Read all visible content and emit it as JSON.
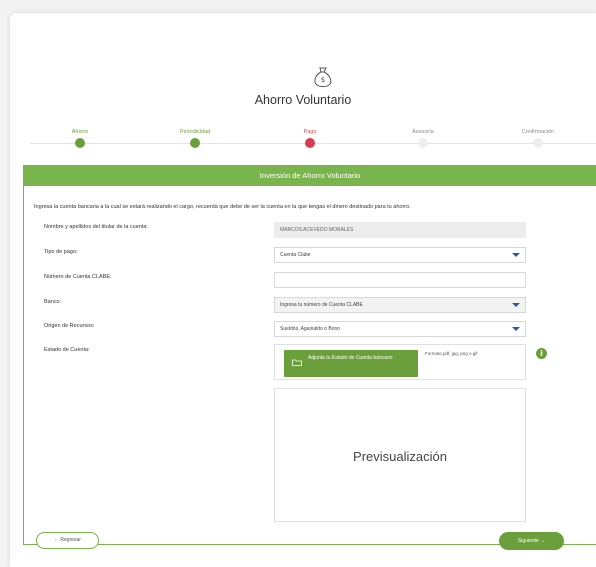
{
  "page": {
    "title": "Ahorro Voluntario",
    "icon": "money-bag-icon"
  },
  "steps": [
    {
      "label": "Ahorro",
      "state": "done"
    },
    {
      "label": "Periodicidad",
      "state": "done"
    },
    {
      "label": "Pago",
      "state": "current"
    },
    {
      "label": "Asesoría",
      "state": "todo"
    },
    {
      "label": "Confirmación",
      "state": "todo"
    }
  ],
  "section": {
    "title": "Inversión de Ahorro Voluntario",
    "intro": "Ingresa la cuenta bancaria a la cual se estará realizando el cargo, recuerda que debe de ser la cuenta en la que tengas el dinero destinado para tu ahorro."
  },
  "form": {
    "holder_label": "Nombre y apellidos del titular de la cuenta:",
    "holder_value": "MARCOS ACEVEDO MORALES",
    "payment_type_label": "Tipo de pago:",
    "payment_type_value": "Cuenta Clabe",
    "clabe_label": "Número de Cuenta CLABE:",
    "clabe_value": "",
    "bank_label": "Banco:",
    "bank_value": "Ingresa tu número de Cuenta CLABE",
    "origin_label": "Origen de Recursos:",
    "origin_value": "Sueldos, Aguinaldo o Bono",
    "statement_label": "Estado de Cuenta:",
    "upload_label": "Adjunta tu Estado de Cuenta bancario",
    "formats": "Formato pdf, jpg, png o gif",
    "preview_label": "Previsualización"
  },
  "nav": {
    "back_label": "← Regresar",
    "next_label": "Siguiente →"
  },
  "colors": {
    "accent": "#7ab44d",
    "button": "#6a9f3b",
    "current_step": "#d93a4e",
    "caret": "#1f5da8"
  }
}
